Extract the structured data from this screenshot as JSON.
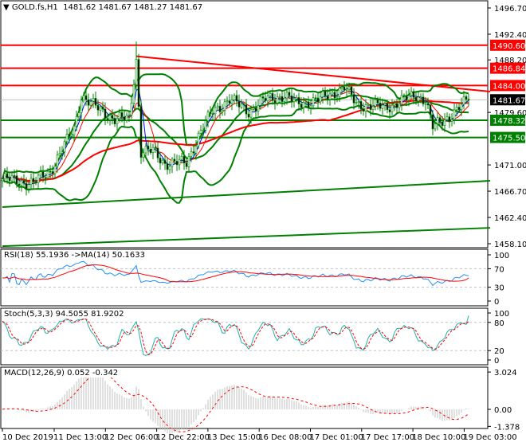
{
  "header": {
    "symbol": "GOLD.fs,H1",
    "open": "1481.62",
    "high": "1481.67",
    "low": "1481.27",
    "close": "1481.67"
  },
  "indicators": {
    "rsi": "RSI(18) 55.1936  ->MA(14) 50.1633",
    "stoch": "Stoch(5,3,3) 94.5055 81.9202",
    "macd": "MACD(12,26,9) 0.052 -0.342"
  },
  "colors": {
    "up": "#ffffff",
    "down": "#000000",
    "wick": "#008000",
    "bands": "#008000",
    "ma_long": "#ff0000",
    "ma_fast": "#0000ff",
    "ma_mid": "#ff0000",
    "res": "#ff0000",
    "sup": "#008000",
    "rsi": "#1e90ff",
    "stoch_main": "#20b2aa",
    "stoch_signal": "#ff0000",
    "macd_hist": "#c0c0c0",
    "macd_signal": "#ff0000"
  },
  "chart_data": [
    {
      "type": "candlestick",
      "title": "GOLD.fs,H1",
      "ylim": [
        1458.1,
        1496.7
      ],
      "y_ticks": [
        "1496.70",
        "1492.40",
        "1488.20",
        "1479.60",
        "1471.00",
        "1466.70",
        "1462.40",
        "1458.10"
      ],
      "x_ticks": [
        "10 Dec 2019",
        "11 Dec 13:00",
        "12 Dec 06:00",
        "12 Dec 22:00",
        "13 Dec 15:00",
        "16 Dec 08:00",
        "17 Dec 01:00",
        "17 Dec 17:00",
        "18 Dec 10:00",
        "19 Dec 03:00"
      ],
      "bars": 196,
      "close_keypoints": [
        [
          0,
          1468.7
        ],
        [
          13,
          1468
        ],
        [
          20,
          1470
        ],
        [
          30,
          1477
        ],
        [
          33,
          1482.4
        ],
        [
          37,
          1481
        ],
        [
          47,
          1478.5
        ],
        [
          53,
          1478.5
        ],
        [
          56,
          1488.2
        ],
        [
          58,
          1473.2
        ],
        [
          63,
          1473.2
        ],
        [
          68,
          1471.3
        ],
        [
          77,
          1471.3
        ],
        [
          82,
          1475.8
        ],
        [
          88,
          1479.8
        ],
        [
          95,
          1481.7
        ],
        [
          103,
          1479.8
        ],
        [
          110,
          1481.7
        ],
        [
          118,
          1482.4
        ],
        [
          123,
          1481
        ],
        [
          133,
          1481.7
        ],
        [
          143,
          1483.7
        ],
        [
          148,
          1481
        ],
        [
          160,
          1480.4
        ],
        [
          173,
          1482.4
        ],
        [
          177,
          1481.7
        ],
        [
          180,
          1477.1
        ],
        [
          187,
          1479
        ],
        [
          195,
          1481.67
        ]
      ],
      "levels": [
        {
          "price": 1490.6,
          "label": "1490.60",
          "kind": "resistance"
        },
        {
          "price": 1486.84,
          "label": "1486.84",
          "kind": "resistance"
        },
        {
          "price": 1484.0,
          "label": "1484.00",
          "kind": "resistance"
        },
        {
          "price": 1478.32,
          "label": "1478.32",
          "kind": "support"
        },
        {
          "price": 1475.5,
          "label": "1475.50",
          "kind": "support"
        }
      ],
      "current_price": {
        "price": 1481.67,
        "label": "1481.67"
      },
      "trendlines": [
        {
          "from": [
            56,
            1488.8
          ],
          "to": [
            204,
            1483.0
          ],
          "kind": "resistance"
        },
        {
          "from": [
            0,
            1464.1
          ],
          "to": [
            204,
            1468.4
          ],
          "kind": "support"
        },
        {
          "from": [
            0,
            1457.7
          ],
          "to": [
            204,
            1460.7
          ],
          "kind": "support"
        }
      ]
    },
    {
      "type": "line",
      "title": "RSI(18)",
      "ylim": [
        0,
        100
      ],
      "y_ticks": [
        "100",
        "70",
        "30",
        "0"
      ],
      "levels": [
        70,
        30
      ],
      "value": 55.1936,
      "ma": 50.1633
    },
    {
      "type": "line",
      "title": "Stoch(5,3,3)",
      "ylim": [
        0,
        100
      ],
      "y_ticks": [
        "100",
        "80",
        "20",
        "0"
      ],
      "levels": [
        80,
        20
      ],
      "main": 94.5055,
      "signal": 81.9202
    },
    {
      "type": "bar",
      "title": "MACD(12,26,9)",
      "ylim": [
        -1.378,
        3.024
      ],
      "y_ticks": [
        "3.024",
        "0.00",
        "-1.378"
      ],
      "macd": 0.052,
      "signal": -0.342
    }
  ]
}
